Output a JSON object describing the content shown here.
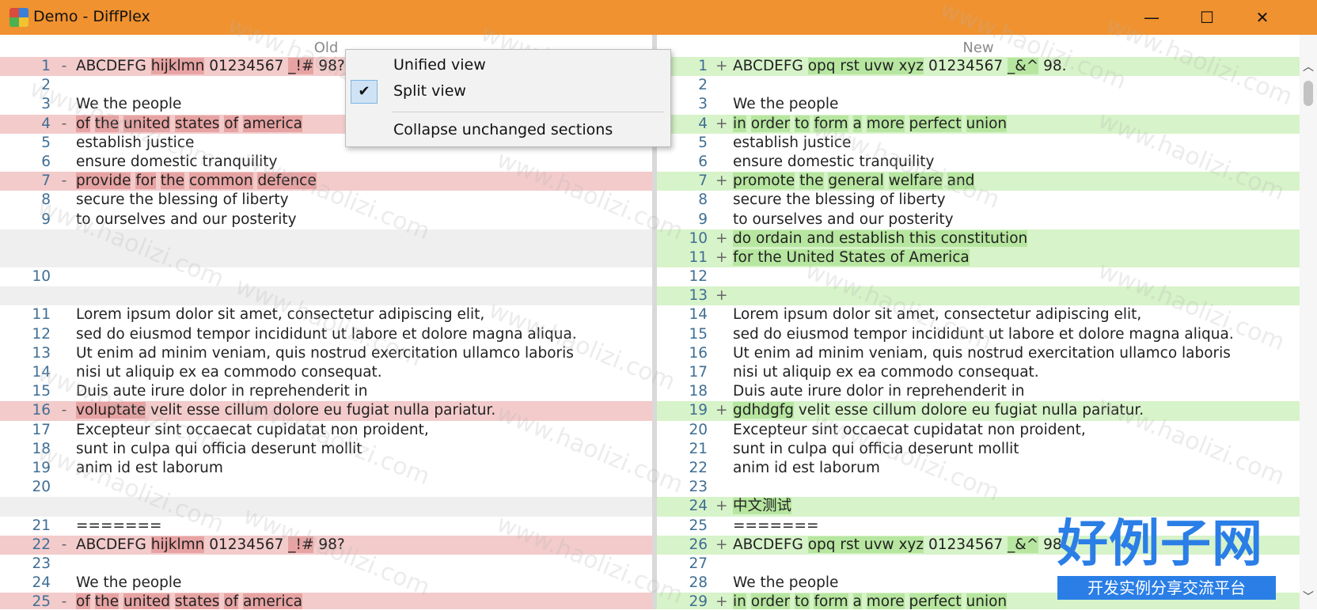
{
  "window": {
    "title": "Demo - DiffPlex"
  },
  "controls": {
    "minimize": "—",
    "maximize": "☐",
    "close": "✕"
  },
  "headers": {
    "old": "Old",
    "new": "New"
  },
  "menu": {
    "items": [
      {
        "label": "Unified view",
        "checked": false
      },
      {
        "label": "Split view",
        "checked": true
      },
      {
        "label": "Collapse unchanged sections",
        "checked": false
      }
    ]
  },
  "left_rows": [
    {
      "num": "1",
      "marker": "-",
      "type": "del",
      "parts": [
        [
          "ABCDEFG ",
          0
        ],
        [
          "hijklmn",
          1
        ],
        [
          " 01234567 ",
          0
        ],
        [
          "_!#",
          1
        ],
        [
          " 98?",
          0
        ]
      ]
    },
    {
      "num": "2",
      "marker": "",
      "type": "",
      "parts": [
        [
          "",
          0
        ]
      ]
    },
    {
      "num": "3",
      "marker": "",
      "type": "",
      "parts": [
        [
          "We the people",
          0
        ]
      ]
    },
    {
      "num": "4",
      "marker": "-",
      "type": "del",
      "parts": [
        [
          "of",
          1
        ],
        [
          " ",
          0
        ],
        [
          "the",
          1
        ],
        [
          " ",
          0
        ],
        [
          "united",
          1
        ],
        [
          " ",
          0
        ],
        [
          "states",
          1
        ],
        [
          " ",
          0
        ],
        [
          "of",
          1
        ],
        [
          " ",
          0
        ],
        [
          "america",
          1
        ]
      ]
    },
    {
      "num": "5",
      "marker": "",
      "type": "",
      "parts": [
        [
          "establish justice",
          0
        ]
      ]
    },
    {
      "num": "6",
      "marker": "",
      "type": "",
      "parts": [
        [
          "ensure domestic tranquility",
          0
        ]
      ]
    },
    {
      "num": "7",
      "marker": "-",
      "type": "del",
      "parts": [
        [
          "provide",
          1
        ],
        [
          " ",
          0
        ],
        [
          "for",
          1
        ],
        [
          " ",
          0
        ],
        [
          "the",
          1
        ],
        [
          " ",
          0
        ],
        [
          "common",
          1
        ],
        [
          " ",
          0
        ],
        [
          "defence",
          1
        ]
      ]
    },
    {
      "num": "8",
      "marker": "",
      "type": "",
      "parts": [
        [
          "secure the blessing of liberty",
          0
        ]
      ]
    },
    {
      "num": "9",
      "marker": "",
      "type": "",
      "parts": [
        [
          "to ourselves and our posterity",
          0
        ]
      ]
    },
    {
      "num": "",
      "marker": "",
      "type": "gap",
      "parts": [
        [
          "",
          0
        ]
      ]
    },
    {
      "num": "",
      "marker": "",
      "type": "gap",
      "parts": [
        [
          "",
          0
        ]
      ]
    },
    {
      "num": "10",
      "marker": "",
      "type": "",
      "parts": [
        [
          "",
          0
        ]
      ]
    },
    {
      "num": "",
      "marker": "",
      "type": "gap",
      "parts": [
        [
          "",
          0
        ]
      ]
    },
    {
      "num": "11",
      "marker": "",
      "type": "",
      "parts": [
        [
          "Lorem ipsum dolor sit amet, consectetur adipiscing elit,",
          0
        ]
      ]
    },
    {
      "num": "12",
      "marker": "",
      "type": "",
      "parts": [
        [
          "sed do eiusmod tempor incididunt ut labore et dolore magna aliqua.",
          0
        ]
      ]
    },
    {
      "num": "13",
      "marker": "",
      "type": "",
      "parts": [
        [
          "Ut enim ad minim veniam, quis nostrud exercitation ullamco laboris",
          0
        ]
      ]
    },
    {
      "num": "14",
      "marker": "",
      "type": "",
      "parts": [
        [
          "nisi ut aliquip ex ea commodo consequat.",
          0
        ]
      ]
    },
    {
      "num": "15",
      "marker": "",
      "type": "",
      "parts": [
        [
          "Duis aute irure dolor in reprehenderit in",
          0
        ]
      ]
    },
    {
      "num": "16",
      "marker": "-",
      "type": "del",
      "parts": [
        [
          "voluptate",
          1
        ],
        [
          " velit esse cillum dolore eu fugiat nulla pariatur.",
          0
        ]
      ]
    },
    {
      "num": "17",
      "marker": "",
      "type": "",
      "parts": [
        [
          "Excepteur sint occaecat cupidatat non proident,",
          0
        ]
      ]
    },
    {
      "num": "18",
      "marker": "",
      "type": "",
      "parts": [
        [
          "sunt in culpa qui officia deserunt mollit",
          0
        ]
      ]
    },
    {
      "num": "19",
      "marker": "",
      "type": "",
      "parts": [
        [
          "anim id est laborum",
          0
        ]
      ]
    },
    {
      "num": "20",
      "marker": "",
      "type": "",
      "parts": [
        [
          "",
          0
        ]
      ]
    },
    {
      "num": "",
      "marker": "",
      "type": "gap",
      "parts": [
        [
          "",
          0
        ]
      ]
    },
    {
      "num": "21",
      "marker": "",
      "type": "",
      "parts": [
        [
          "=======",
          0
        ]
      ]
    },
    {
      "num": "22",
      "marker": "-",
      "type": "del",
      "parts": [
        [
          "ABCDEFG ",
          0
        ],
        [
          "hijklmn",
          1
        ],
        [
          " 01234567 ",
          0
        ],
        [
          "_!#",
          1
        ],
        [
          " 98?",
          0
        ]
      ]
    },
    {
      "num": "23",
      "marker": "",
      "type": "",
      "parts": [
        [
          "",
          0
        ]
      ]
    },
    {
      "num": "24",
      "marker": "",
      "type": "",
      "parts": [
        [
          "We the people",
          0
        ]
      ]
    },
    {
      "num": "25",
      "marker": "-",
      "type": "del",
      "parts": [
        [
          "of",
          1
        ],
        [
          " ",
          0
        ],
        [
          "the",
          1
        ],
        [
          " ",
          0
        ],
        [
          "united",
          1
        ],
        [
          " ",
          0
        ],
        [
          "states",
          1
        ],
        [
          " ",
          0
        ],
        [
          "of",
          1
        ],
        [
          " ",
          0
        ],
        [
          "america",
          1
        ]
      ]
    }
  ],
  "right_rows": [
    {
      "num": "1",
      "marker": "+",
      "type": "ins",
      "parts": [
        [
          "ABCDEFG ",
          0
        ],
        [
          "opq rst uvw xyz",
          1
        ],
        [
          " 01234567 ",
          0
        ],
        [
          "_&^",
          1
        ],
        [
          " 98.",
          0
        ]
      ]
    },
    {
      "num": "2",
      "marker": "",
      "type": "",
      "parts": [
        [
          "",
          0
        ]
      ]
    },
    {
      "num": "3",
      "marker": "",
      "type": "",
      "parts": [
        [
          "We the people",
          0
        ]
      ]
    },
    {
      "num": "4",
      "marker": "+",
      "type": "ins",
      "parts": [
        [
          "in",
          1
        ],
        [
          " ",
          0
        ],
        [
          "order",
          1
        ],
        [
          " ",
          0
        ],
        [
          "to",
          1
        ],
        [
          " ",
          0
        ],
        [
          "form",
          1
        ],
        [
          " ",
          0
        ],
        [
          "a",
          1
        ],
        [
          " ",
          0
        ],
        [
          "more",
          1
        ],
        [
          " ",
          0
        ],
        [
          "perfect",
          1
        ],
        [
          " ",
          0
        ],
        [
          "union",
          1
        ]
      ]
    },
    {
      "num": "5",
      "marker": "",
      "type": "",
      "parts": [
        [
          "establish justice",
          0
        ]
      ]
    },
    {
      "num": "6",
      "marker": "",
      "type": "",
      "parts": [
        [
          "ensure domestic tranquility",
          0
        ]
      ]
    },
    {
      "num": "7",
      "marker": "+",
      "type": "ins",
      "parts": [
        [
          "promote",
          1
        ],
        [
          " ",
          0
        ],
        [
          "the",
          1
        ],
        [
          " ",
          0
        ],
        [
          "general",
          1
        ],
        [
          " ",
          0
        ],
        [
          "welfare",
          1
        ],
        [
          " ",
          0
        ],
        [
          "and",
          1
        ]
      ]
    },
    {
      "num": "8",
      "marker": "",
      "type": "",
      "parts": [
        [
          "secure the blessing of liberty",
          0
        ]
      ]
    },
    {
      "num": "9",
      "marker": "",
      "type": "",
      "parts": [
        [
          "to ourselves and our posterity",
          0
        ]
      ]
    },
    {
      "num": "10",
      "marker": "+",
      "type": "ins",
      "parts": [
        [
          "do ordain and establish this constitution",
          1
        ]
      ]
    },
    {
      "num": "11",
      "marker": "+",
      "type": "ins",
      "parts": [
        [
          "for the United States of America",
          1
        ]
      ]
    },
    {
      "num": "12",
      "marker": "",
      "type": "",
      "parts": [
        [
          "",
          0
        ]
      ]
    },
    {
      "num": "13",
      "marker": "+",
      "type": "ins",
      "parts": [
        [
          "",
          0
        ]
      ]
    },
    {
      "num": "14",
      "marker": "",
      "type": "",
      "parts": [
        [
          "Lorem ipsum dolor sit amet, consectetur adipiscing elit,",
          0
        ]
      ]
    },
    {
      "num": "15",
      "marker": "",
      "type": "",
      "parts": [
        [
          "sed do eiusmod tempor incididunt ut labore et dolore magna aliqua.",
          0
        ]
      ]
    },
    {
      "num": "16",
      "marker": "",
      "type": "",
      "parts": [
        [
          "Ut enim ad minim veniam, quis nostrud exercitation ullamco laboris",
          0
        ]
      ]
    },
    {
      "num": "17",
      "marker": "",
      "type": "",
      "parts": [
        [
          "nisi ut aliquip ex ea commodo consequat.",
          0
        ]
      ]
    },
    {
      "num": "18",
      "marker": "",
      "type": "",
      "parts": [
        [
          "Duis aute irure dolor in reprehenderit in",
          0
        ]
      ]
    },
    {
      "num": "19",
      "marker": "+",
      "type": "ins",
      "parts": [
        [
          "gdhdgfg",
          1
        ],
        [
          " velit esse cillum dolore eu fugiat nulla pariatur.",
          0
        ]
      ]
    },
    {
      "num": "20",
      "marker": "",
      "type": "",
      "parts": [
        [
          "Excepteur sint occaecat cupidatat non proident,",
          0
        ]
      ]
    },
    {
      "num": "21",
      "marker": "",
      "type": "",
      "parts": [
        [
          "sunt in culpa qui officia deserunt mollit",
          0
        ]
      ]
    },
    {
      "num": "22",
      "marker": "",
      "type": "",
      "parts": [
        [
          "anim id est laborum",
          0
        ]
      ]
    },
    {
      "num": "23",
      "marker": "",
      "type": "",
      "parts": [
        [
          "",
          0
        ]
      ]
    },
    {
      "num": "24",
      "marker": "+",
      "type": "ins",
      "parts": [
        [
          "中文测试",
          1
        ]
      ]
    },
    {
      "num": "25",
      "marker": "",
      "type": "",
      "parts": [
        [
          "=======",
          0
        ]
      ]
    },
    {
      "num": "26",
      "marker": "+",
      "type": "ins",
      "parts": [
        [
          "ABCDEFG ",
          0
        ],
        [
          "opq rst uvw xyz",
          1
        ],
        [
          " 01234567 ",
          0
        ],
        [
          "_&^",
          1
        ],
        [
          " 98.",
          0
        ]
      ]
    },
    {
      "num": "27",
      "marker": "",
      "type": "",
      "parts": [
        [
          "",
          0
        ]
      ]
    },
    {
      "num": "28",
      "marker": "",
      "type": "",
      "parts": [
        [
          "We the people",
          0
        ]
      ]
    },
    {
      "num": "29",
      "marker": "+",
      "type": "ins",
      "parts": [
        [
          "in",
          1
        ],
        [
          " ",
          0
        ],
        [
          "order",
          1
        ],
        [
          " ",
          0
        ],
        [
          "to",
          1
        ],
        [
          " ",
          0
        ],
        [
          "form",
          1
        ],
        [
          " ",
          0
        ],
        [
          "a",
          1
        ],
        [
          " ",
          0
        ],
        [
          "more",
          1
        ],
        [
          " ",
          0
        ],
        [
          "perfect",
          1
        ],
        [
          " ",
          0
        ],
        [
          "union",
          1
        ]
      ]
    }
  ],
  "watermark": {
    "text": "www.haolizi.com"
  },
  "brand": {
    "title": "好例子网",
    "subtitle": "开发实例分享交流平台"
  },
  "colors": {
    "titlebar": "#f0922f",
    "deleted_line": "#f3cbcb",
    "inserted_line": "#d7f3c9",
    "accent": "#2a7ee6"
  }
}
